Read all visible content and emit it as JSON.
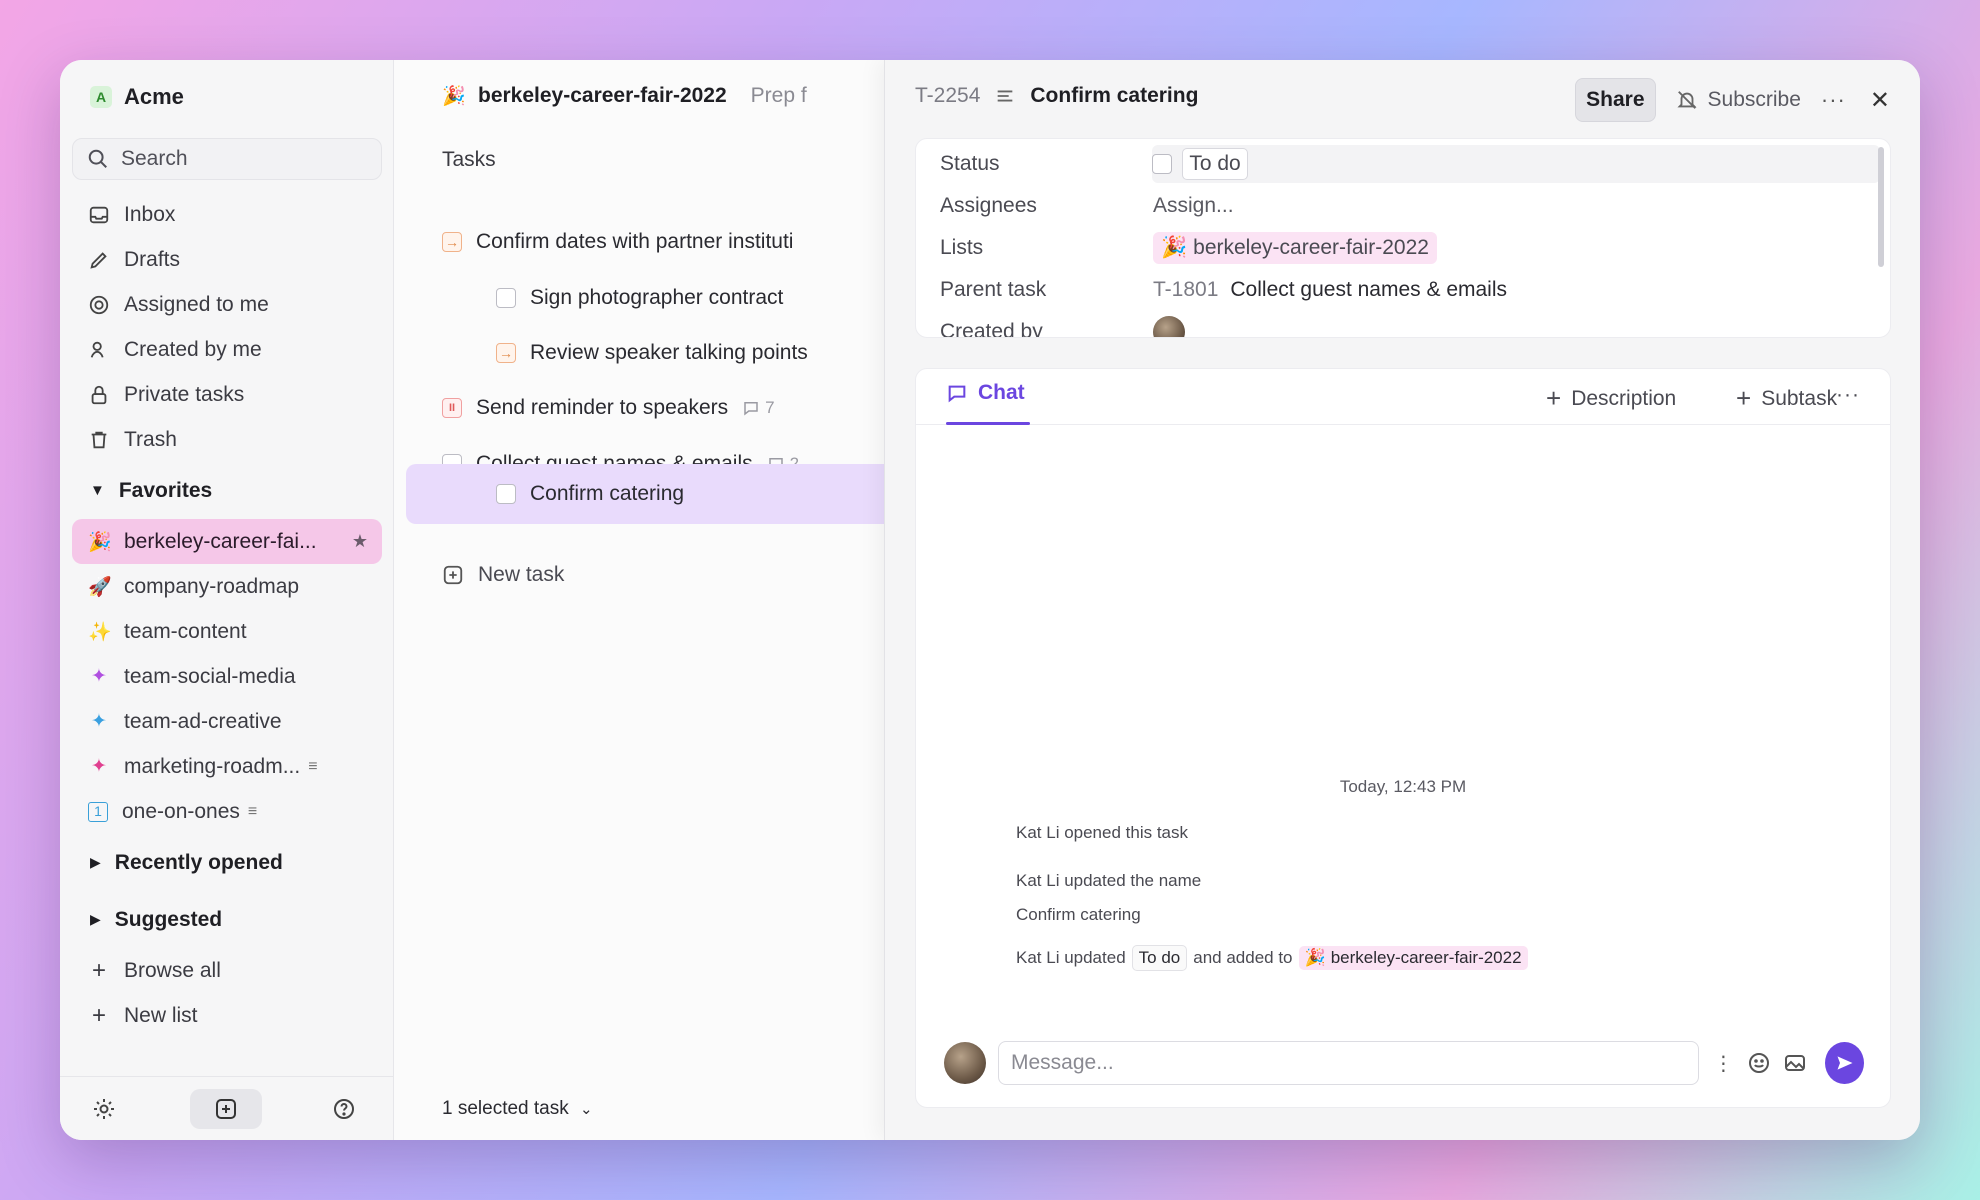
{
  "workspace": {
    "badge": "A",
    "name": "Acme"
  },
  "search": {
    "placeholder": "Search"
  },
  "nav": [
    {
      "label": "Inbox",
      "icon": "inbox-icon"
    },
    {
      "label": "Drafts",
      "icon": "pencil-icon"
    },
    {
      "label": "Assigned to me",
      "icon": "target-icon"
    },
    {
      "label": "Created by me",
      "icon": "user-icon"
    },
    {
      "label": "Private tasks",
      "icon": "lock-icon"
    },
    {
      "label": "Trash",
      "icon": "trash-icon"
    }
  ],
  "favorites_label": "Favorites",
  "favorites": [
    {
      "label": "berkeley-career-fai...",
      "icon": "party-popper-icon",
      "active": true
    },
    {
      "label": "company-roadmap",
      "icon": "rocket-icon"
    },
    {
      "label": "team-content",
      "icon": "sparkle-icon"
    },
    {
      "label": "team-social-media",
      "icon": "sparkle-icon"
    },
    {
      "label": "team-ad-creative",
      "icon": "sparkle-icon"
    },
    {
      "label": "marketing-roadm...",
      "icon": "sparkle-icon"
    },
    {
      "label": "one-on-ones",
      "icon": "calendar-icon"
    }
  ],
  "recently_opened": "Recently opened",
  "suggested": "Suggested",
  "browse_all": "Browse all",
  "new_list": "New list",
  "list": {
    "title": "berkeley-career-fair-2022",
    "crumb": "Prep f",
    "tasks_heading": "Tasks",
    "tasks": [
      {
        "label": "Confirm dates with partner instituti",
        "status": "next"
      },
      {
        "label": "Sign photographer contract",
        "status": "todo"
      },
      {
        "label": "Review speaker talking points",
        "status": "next"
      },
      {
        "label": "Send reminder to speakers",
        "status": "paused",
        "comments": "7"
      },
      {
        "label": "Collect guest names & emails",
        "status": "todo",
        "comments": "2"
      },
      {
        "label": "Confirm catering",
        "status": "todo",
        "selected": true
      }
    ],
    "new_task": "New task",
    "footer": "1 selected task"
  },
  "detail": {
    "id": "T-2254",
    "name": "Confirm catering",
    "share": "Share",
    "subscribe": "Subscribe",
    "props": {
      "status_label": "Status",
      "status_value": "To do",
      "assignees_label": "Assignees",
      "assignees_placeholder": "Assign...",
      "lists_label": "Lists",
      "lists_value": "berkeley-career-fair-2022",
      "parent_label": "Parent task",
      "parent_id": "T-1801",
      "parent_name": "Collect guest names & emails",
      "created_label": "Created by"
    },
    "chat": {
      "tab": "Chat",
      "description": "Description",
      "subtask": "Subtask",
      "timestamp": "Today, 12:43 PM",
      "events": {
        "opened": "Kat Li opened this task",
        "updated_name": "Kat Li updated the name",
        "new_name": "Confirm catering",
        "updated_prefix": "Kat Li updated",
        "status_chip": "To do",
        "added_to": "and added to",
        "list_chip": "berkeley-career-fair-2022"
      },
      "message_placeholder": "Message..."
    }
  },
  "colors": {
    "accent": "#6b46e0",
    "favorite_active": "#f5c7e8",
    "selected_task": "#e9dbfc"
  }
}
